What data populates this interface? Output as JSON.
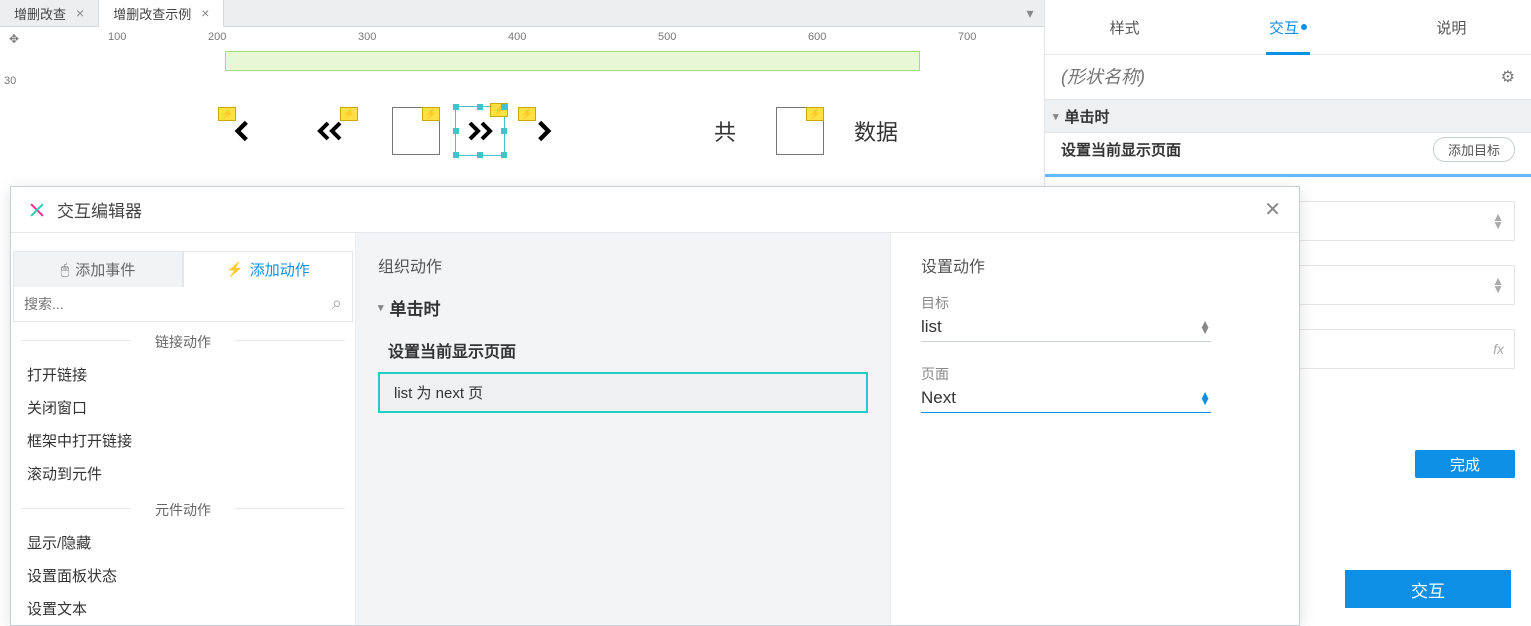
{
  "tabs": {
    "items": [
      "增删改查",
      "增删改查示例"
    ],
    "activeIndex": 1
  },
  "ruler": {
    "ticks": [
      100,
      200,
      300,
      400,
      500,
      600,
      700
    ],
    "vtick": 30
  },
  "canvas": {
    "label1": "共",
    "label2": "数据"
  },
  "inspector": {
    "tabs": {
      "style": "样式",
      "interact": "交互",
      "notes": "说明"
    },
    "placeholder": "(形状名称)",
    "event": "单击时",
    "actionHdr": "设置当前显示页面",
    "addTarget": "添加目标",
    "done": "完成",
    "newInteraction": "交互"
  },
  "dialog": {
    "title": "交互编辑器",
    "leftTabs": {
      "events": "添加事件",
      "actions": "添加动作"
    },
    "searchPlaceholder": "搜索...",
    "catLinks": "链接动作",
    "catWidgets": "元件动作",
    "linkActions": [
      "打开链接",
      "关闭窗口",
      "框架中打开链接",
      "滚动到元件"
    ],
    "widgetActions": [
      "显示/隐藏",
      "设置面板状态",
      "设置文本"
    ],
    "mid": {
      "title": "组织动作",
      "event": "单击时",
      "actionHdr": "设置当前显示页面",
      "case": "list 为 next 页"
    },
    "right": {
      "title": "设置动作",
      "targetLabel": "目标",
      "targetValue": "list",
      "pageLabel": "页面",
      "pageValue": "Next"
    }
  }
}
